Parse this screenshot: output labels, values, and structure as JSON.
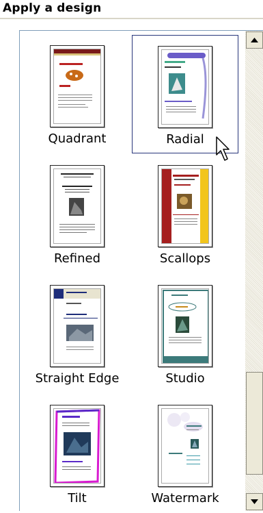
{
  "panel": {
    "title": "Apply a design"
  },
  "designs": [
    {
      "label": "Quadrant",
      "selected": false
    },
    {
      "label": "Radial",
      "selected": true
    },
    {
      "label": "Refined",
      "selected": false
    },
    {
      "label": "Scallops",
      "selected": false
    },
    {
      "label": "Straight Edge",
      "selected": false
    },
    {
      "label": "Studio",
      "selected": false
    },
    {
      "label": "Tilt",
      "selected": false
    },
    {
      "label": "Watermark",
      "selected": false
    }
  ],
  "colors": {
    "selection_border": "#27357a",
    "scallops_red": "#a51f1f",
    "scallops_yellow": "#f2c51c",
    "studio_teal": "#3c7a7a",
    "tilt_magenta": "#d81bd0",
    "straight_edge_navy": "#1e2d7a"
  },
  "icons": {
    "scroll_up": "arrow-up-icon",
    "scroll_down": "arrow-down-icon",
    "cursor": "mouse-pointer-icon"
  }
}
